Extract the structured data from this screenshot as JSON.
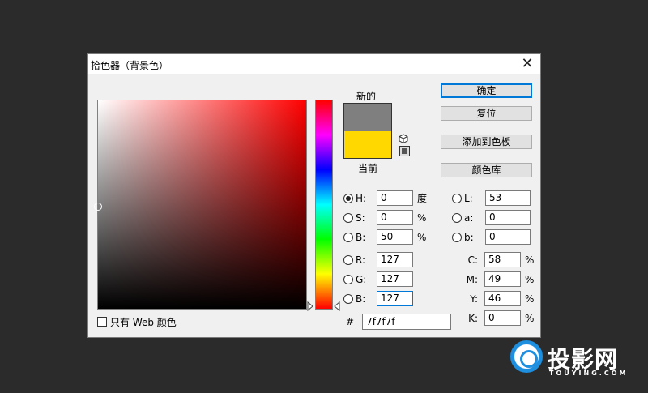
{
  "dialog": {
    "title": "拾色器（背景色）",
    "close_glyph": "✕"
  },
  "swatches": {
    "new_label": "新的",
    "current_label": "当前",
    "new_color": "#7f7f7f",
    "current_color": "#ffd800"
  },
  "buttons": {
    "ok": "确定",
    "reset": "复位",
    "add_to_swatches": "添加到色板",
    "color_libraries": "颜色库"
  },
  "hsb": {
    "h": {
      "label": "H:",
      "value": "0",
      "unit": "度",
      "checked": true
    },
    "s": {
      "label": "S:",
      "value": "0",
      "unit": "%"
    },
    "b": {
      "label": "B:",
      "value": "50",
      "unit": "%"
    }
  },
  "rgb": {
    "r": {
      "label": "R:",
      "value": "127"
    },
    "g": {
      "label": "G:",
      "value": "127"
    },
    "b": {
      "label": "B:",
      "value": "127"
    }
  },
  "lab": {
    "l": {
      "label": "L:",
      "value": "53"
    },
    "a": {
      "label": "a:",
      "value": "0"
    },
    "b": {
      "label": "b:",
      "value": "0"
    }
  },
  "cmyk": {
    "c": {
      "label": "C:",
      "value": "58",
      "unit": "%"
    },
    "m": {
      "label": "M:",
      "value": "49",
      "unit": "%"
    },
    "y": {
      "label": "Y:",
      "value": "46",
      "unit": "%"
    },
    "k": {
      "label": "K:",
      "value": "0",
      "unit": "%"
    }
  },
  "hex": {
    "label": "#",
    "value": "7f7f7f"
  },
  "web_only": {
    "label": "只有 Web 颜色"
  },
  "watermark": {
    "name": "投影网",
    "site": "TOUYING.COM"
  },
  "colors": {
    "background": "#2b2b2b",
    "dialog": "#f0f0f0",
    "accent": "#0078d7",
    "watermark_blue": "#1e8ede"
  }
}
